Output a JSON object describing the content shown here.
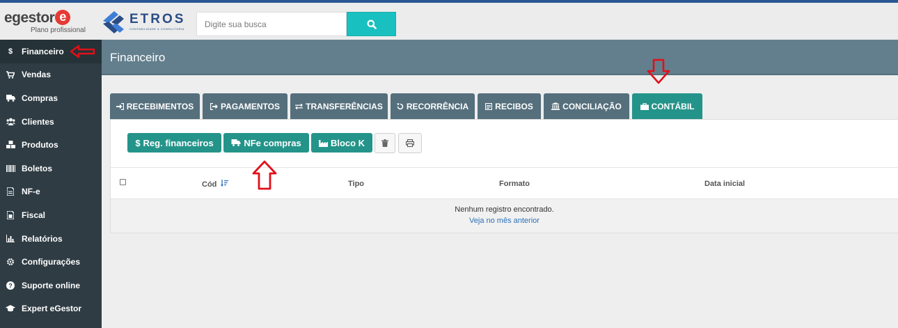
{
  "header": {
    "brand_word": "egestor",
    "brand_mark": "e",
    "plan_label": "Plano profissional",
    "partner_name": "ETROS",
    "partner_sub": "CONTABILIDADE & CONSULTORIA",
    "search": {
      "placeholder": "Digite sua busca",
      "value": ""
    }
  },
  "sidebar": {
    "items": [
      {
        "label": "Financeiro",
        "icon": "dollar-icon",
        "active": true
      },
      {
        "label": "Vendas",
        "icon": "cart-icon"
      },
      {
        "label": "Compras",
        "icon": "truck-icon"
      },
      {
        "label": "Clientes",
        "icon": "users-icon"
      },
      {
        "label": "Produtos",
        "icon": "cubes-icon"
      },
      {
        "label": "Boletos",
        "icon": "barcode-icon"
      },
      {
        "label": "NF-e",
        "icon": "document-icon"
      },
      {
        "label": "Fiscal",
        "icon": "fiscal-doc-icon"
      },
      {
        "label": "Relatórios",
        "icon": "bar-chart-icon"
      },
      {
        "label": "Configurações",
        "icon": "gear-icon"
      },
      {
        "label": "Suporte online",
        "icon": "question-icon"
      },
      {
        "label": "Expert eGestor",
        "icon": "graduation-cap-icon"
      }
    ]
  },
  "page": {
    "title": "Financeiro"
  },
  "tabs": [
    {
      "label": "RECEBIMENTOS",
      "icon": "sign-in-icon"
    },
    {
      "label": "PAGAMENTOS",
      "icon": "sign-out-icon"
    },
    {
      "label": "TRANSFERÊNCIAS",
      "icon": "exchange-icon"
    },
    {
      "label": "RECORRÊNCIA",
      "icon": "refresh-icon"
    },
    {
      "label": "RECIBOS",
      "icon": "receipt-icon"
    },
    {
      "label": "CONCILIAÇÃO",
      "icon": "bank-icon"
    },
    {
      "label": "CONTÁBIL",
      "icon": "briefcase-icon",
      "active": true
    }
  ],
  "toolbar": {
    "reg_financeiros": "Reg. financeiros",
    "nfe_compras": "NFe compras",
    "bloco_k": "Bloco K",
    "reg_symbol": "$"
  },
  "table": {
    "columns": [
      "Cód",
      "Tipo",
      "Formato",
      "Data inicial"
    ],
    "empty_message": "Nenhum registro encontrado.",
    "empty_link": "Veja no mês anterior"
  },
  "colors": {
    "accent_teal": "#24948a",
    "tab_slate": "#556f7c",
    "header_band": "#637f8d",
    "sidebar_bg": "#2f3c44",
    "search_button": "#19c0c0",
    "annotation_red": "#e0101a",
    "link_blue": "#2d6fb7"
  }
}
